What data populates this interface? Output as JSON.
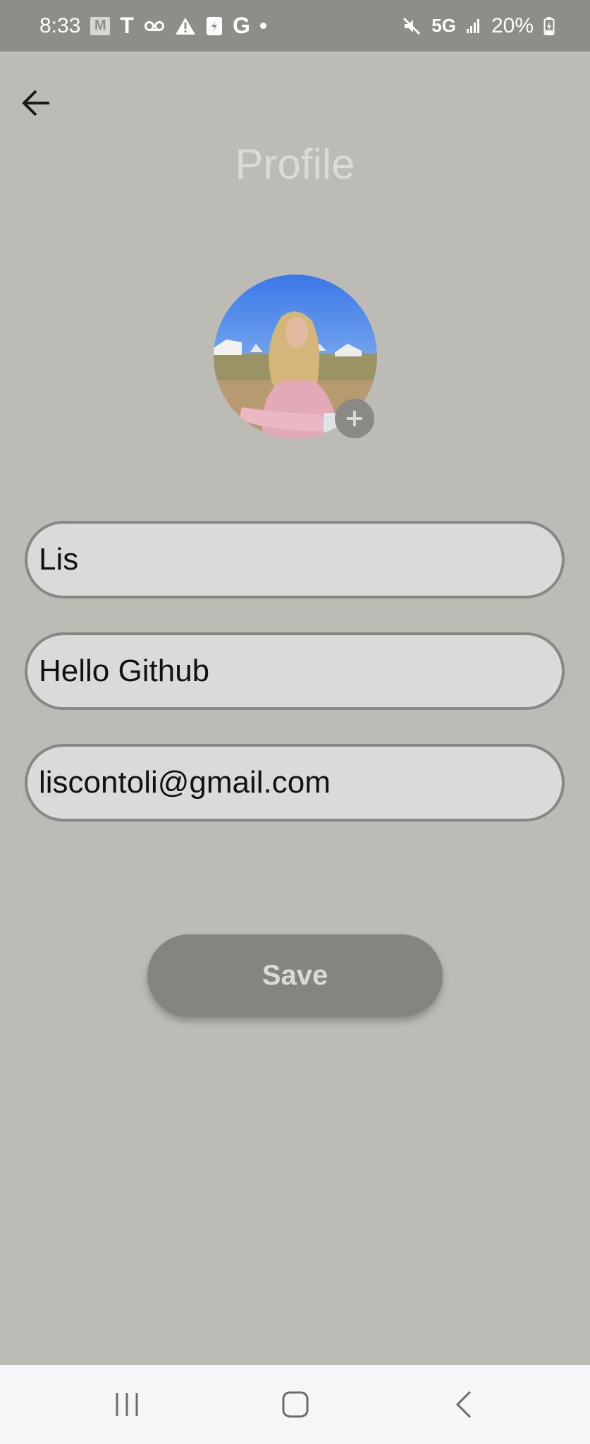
{
  "status_bar": {
    "time": "8:33",
    "m_badge": "M",
    "carrier_icon": "T",
    "google_icon": "G",
    "network": "5G",
    "battery": "20%",
    "icons": [
      "gmail-icon",
      "tmobile-icon",
      "voicemail-icon",
      "alert-icon",
      "nfc-icon",
      "google-icon",
      "dot-icon",
      "mute-icon",
      "signal-icon",
      "battery-icon"
    ]
  },
  "header": {
    "title": "Profile",
    "back_icon": "arrow-left-icon"
  },
  "profile": {
    "avatar_alt": "profile-photo",
    "add_photo_icon": "plus-icon"
  },
  "form": {
    "name": "Lis",
    "bio": "Hello Github",
    "email": "liscontoli@gmail.com"
  },
  "actions": {
    "save_label": "Save"
  },
  "colors": {
    "background": "#bdbbb6",
    "status_bar": "#8e8d89",
    "field_bg": "#dadada",
    "field_border": "#888784",
    "button_bg": "#858480",
    "title_text": "#dcdad6"
  },
  "nav_bar": {
    "items": [
      "recent-apps-icon",
      "home-icon",
      "back-icon"
    ]
  }
}
